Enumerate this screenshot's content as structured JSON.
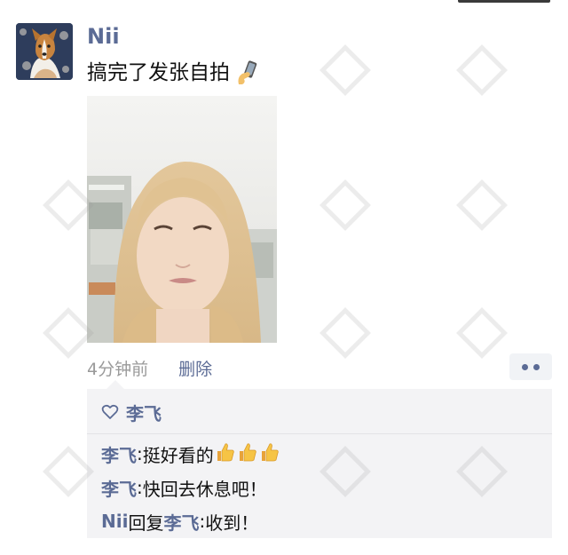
{
  "post": {
    "username": "Nii",
    "text": "搞完了发张自拍",
    "text_emoji": "phone-selfie-emoji"
  },
  "meta": {
    "timestamp": "4分钟前",
    "delete_label": "删除",
    "more_icon": "more-dots-icon"
  },
  "likes": {
    "names": [
      "李飞"
    ]
  },
  "comments": [
    {
      "author": "李飞",
      "separator": ": ",
      "text": "挺好看的",
      "emoji_count": 3,
      "emoji": "thumbs-up-emoji"
    },
    {
      "author": "李飞",
      "separator": ": ",
      "text": "快回去休息吧！"
    },
    {
      "author": "Nii",
      "reply_word": "回复",
      "reply_to": "李飞",
      "separator": ": ",
      "text": "收到！"
    }
  ],
  "colors": {
    "link": "#5b6b95",
    "text": "#111111",
    "muted": "#9a9a9a",
    "comment_bg": "#f3f3f5"
  }
}
